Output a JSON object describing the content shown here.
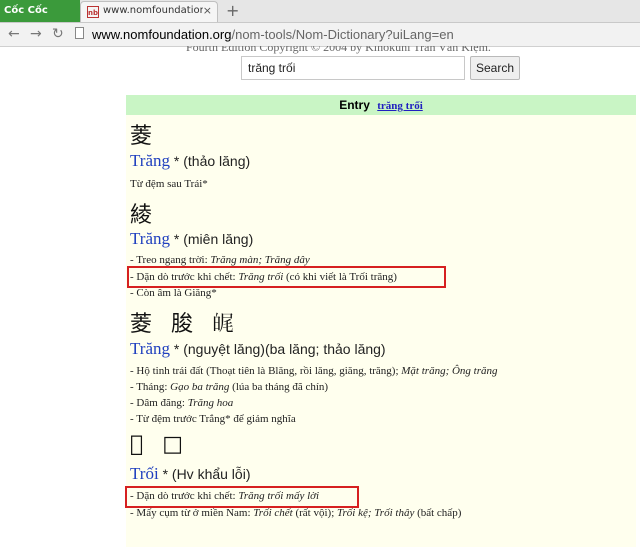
{
  "browser": {
    "logo_text": "Cốc Cốc",
    "tab_title": "www.nomfoundation.org/",
    "tab_favicon_text": "nb",
    "tab_close": "×",
    "new_tab": "+",
    "url_domain": "www.nomfoundation.org",
    "url_path": "/nom-tools/Nom-Dictionary?uiLang=en"
  },
  "page": {
    "covered_text": "Fourth Edition Copyright © 2004 by Kinokuni Trần Văn Kiệm.",
    "search_value": "trăng trối",
    "search_button": "Search",
    "entry_label": "Entry",
    "entry_link": "trăng trối",
    "entries": [
      {
        "han": "菱",
        "word": "Trăng",
        "gloss": "* (thảo lăng)",
        "lines": [
          "Từ đệm sau Trái*"
        ]
      },
      {
        "han": "綾",
        "word": "Trăng",
        "gloss": "* (miên lăng)",
        "l1_pre": "- Treo ngang trời: ",
        "l1_it": "Trăng màn; Trăng dây",
        "l2_pre": "- Dặn dò trước khi chết: ",
        "l2_it": "Trăng trối",
        "l2_post": " (có khi viết là Trối trăng)",
        "l3": "- Còn âm là Giăng*"
      },
      {
        "han": "菱 朘 𤽶",
        "word": "Trăng",
        "gloss": "* (nguyệt lăng)(ba lăng; thảo lăng)",
        "l1_pre": "- Hộ tinh trái đất (Thoạt tiên là Blăng, rồi lăng, giăng, trăng); ",
        "l1_it": "Mặt trăng; Ông trăng",
        "l2_pre": "- Tháng: ",
        "l2_it": "Gạo ba trăng",
        "l2_post": " (lúa ba tháng đã chín)",
        "l3_pre": "- Dâm đãng: ",
        "l3_it": "Trăng hoa",
        "l4": "- Từ đệm trước Trắng* để giảm nghĩa"
      },
      {
        "han": "𠿯 □",
        "word": "Trối",
        "gloss": "* (Hv khẩu lỗi)",
        "l1_pre": "- Dặn dò trước khi chết: ",
        "l1_it": "Trăng trối mấy lời",
        "l2_pre": "- Mấy cụm từ ở miền Nam: ",
        "l2_it": "Trối chết",
        "l2_mid": " (rất vội); ",
        "l2_it2": "Trối kệ; Trối thây",
        "l2_post": " (bất chấp)"
      }
    ]
  },
  "colors": {
    "highlight": "#d62020",
    "entry_header_bg": "#c9f5c5",
    "panel_bg": "#ffffee",
    "headword": "#1f3fbf"
  }
}
